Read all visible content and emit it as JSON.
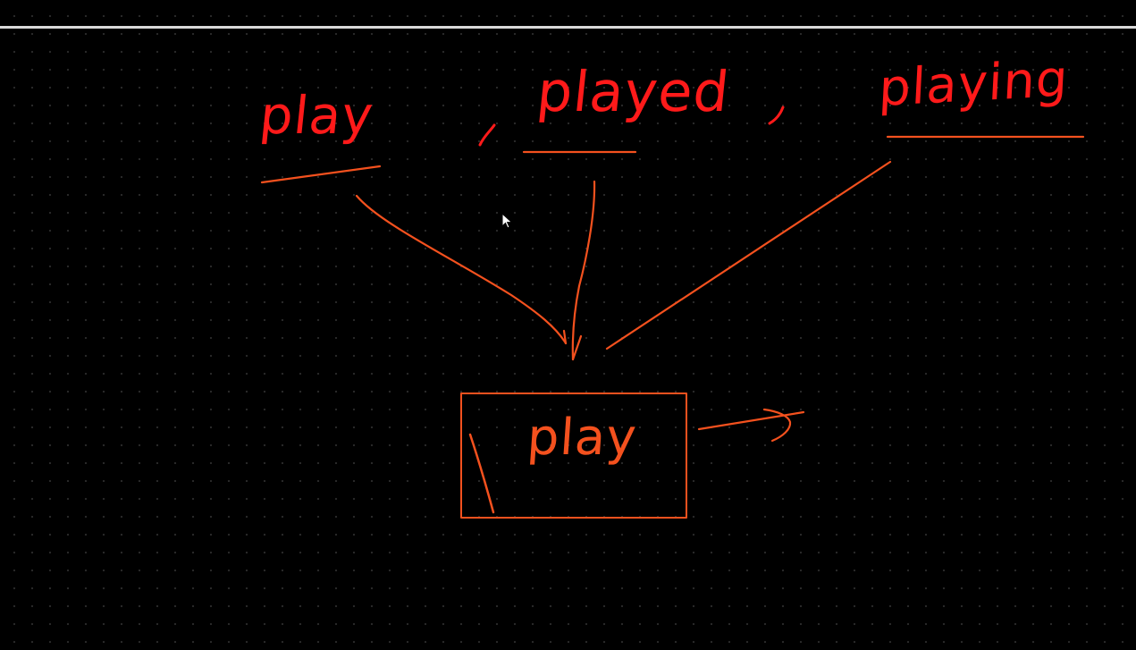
{
  "whiteboard": {
    "words": {
      "play": "play",
      "played": "played",
      "playing": "playing"
    },
    "box_word": "play"
  },
  "colors": {
    "background": "#000000",
    "grid_dot": "#2a2a2a",
    "top_rule": "#d9d9d9",
    "word_ink": "#ff1a1a",
    "line_ink": "#f4511e"
  },
  "icons": {
    "cursor": "mouse-pointer-icon"
  }
}
